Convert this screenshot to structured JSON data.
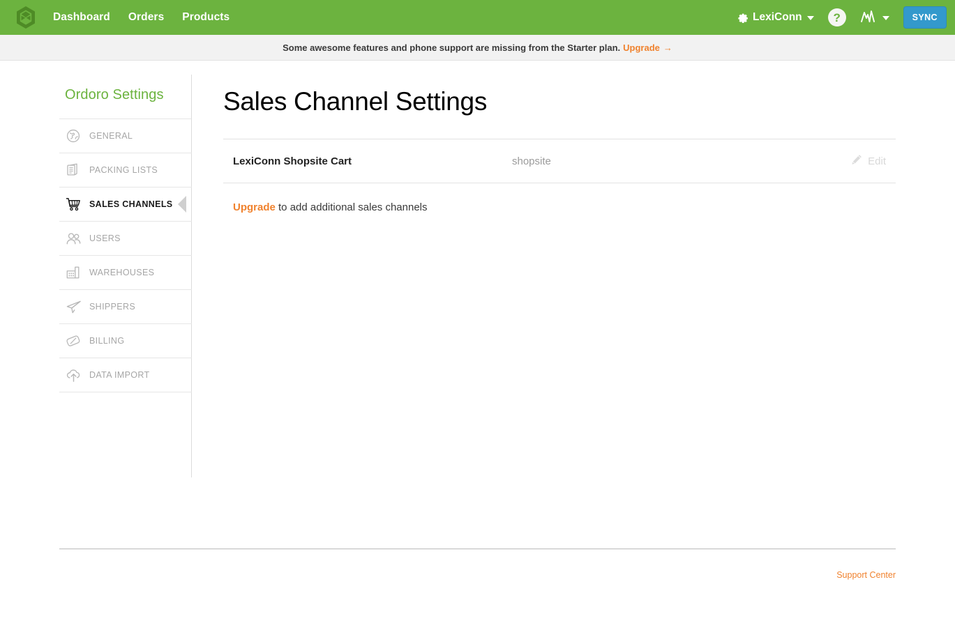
{
  "topnav": {
    "logo_name": "ordoro-logo",
    "links": [
      {
        "label": "Dashboard"
      },
      {
        "label": "Orders"
      },
      {
        "label": "Products"
      }
    ],
    "account_label": "LexiConn",
    "help_label": "?",
    "sync_label": "SYNC",
    "background_color": "#6cb33f",
    "sync_color": "#3399cc"
  },
  "notice": {
    "text": "Some awesome features and phone support are missing from the Starter plan.",
    "link_label": "Upgrade",
    "arrow": "→",
    "link_color": "#f0822e"
  },
  "sidebar": {
    "title": "Ordoro Settings",
    "items": [
      {
        "label": "GENERAL",
        "icon": "globe-icon"
      },
      {
        "label": "PACKING LISTS",
        "icon": "documents-icon"
      },
      {
        "label": "SALES CHANNELS",
        "icon": "shopping-cart-icon"
      },
      {
        "label": "USERS",
        "icon": "users-icon"
      },
      {
        "label": "WAREHOUSES",
        "icon": "factory-icon"
      },
      {
        "label": "SHIPPERS",
        "icon": "paper-plane-icon"
      },
      {
        "label": "BILLING",
        "icon": "tag-icon"
      },
      {
        "label": "DATA IMPORT",
        "icon": "cloud-upload-icon"
      }
    ],
    "active_index": 2
  },
  "main": {
    "title": "Sales Channel Settings",
    "channels": [
      {
        "name": "LexiConn Shopsite Cart",
        "type": "shopsite",
        "edit_label": "Edit"
      }
    ],
    "upgrade_prefix": "Upgrade",
    "upgrade_suffix": " to add additional sales channels"
  },
  "footer": {
    "support_label": "Support Center"
  }
}
